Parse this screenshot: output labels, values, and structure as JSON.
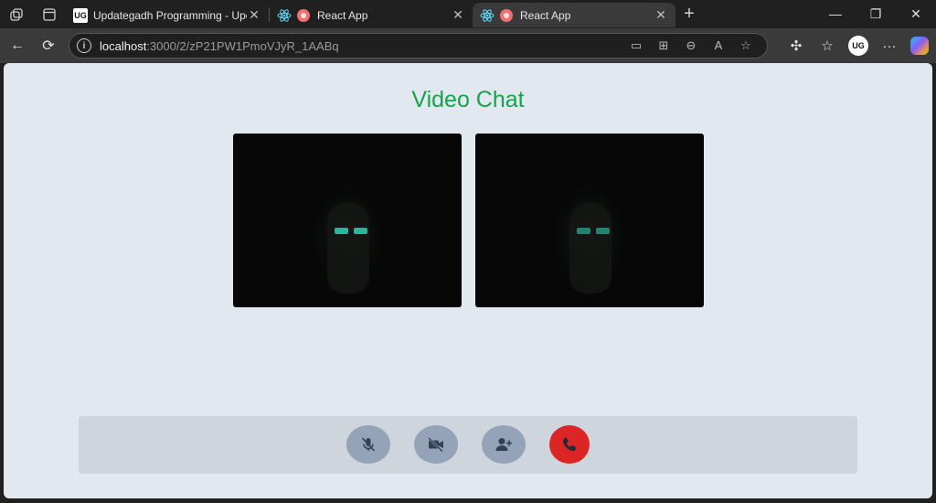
{
  "browser": {
    "tabs": [
      {
        "title": "Updategadh Programming - Upd",
        "favicon": "ug-logo",
        "active": false
      },
      {
        "title": "React App",
        "favicon": "react-logo",
        "active": false,
        "recording": true
      },
      {
        "title": "React App",
        "favicon": "react-logo",
        "active": true,
        "recording": true
      }
    ],
    "address": {
      "host": "localhost",
      "path": ":3000/2/zP21PW1PmoVJyR_1AABq"
    },
    "profile_initials": "UG",
    "ug_favicon_text": "UG"
  },
  "page": {
    "title": "Video Chat",
    "title_color": "#16a34a",
    "background": "#e2e8f0",
    "videos": [
      {
        "label": "local-video"
      },
      {
        "label": "remote-video"
      }
    ],
    "controls": {
      "mute_icon": "mic-off-icon",
      "camera_icon": "video-off-icon",
      "add_user_icon": "user-plus-icon",
      "end_call_icon": "phone-icon",
      "end_call_color": "#dc2626",
      "button_color": "#94a3b8"
    }
  }
}
